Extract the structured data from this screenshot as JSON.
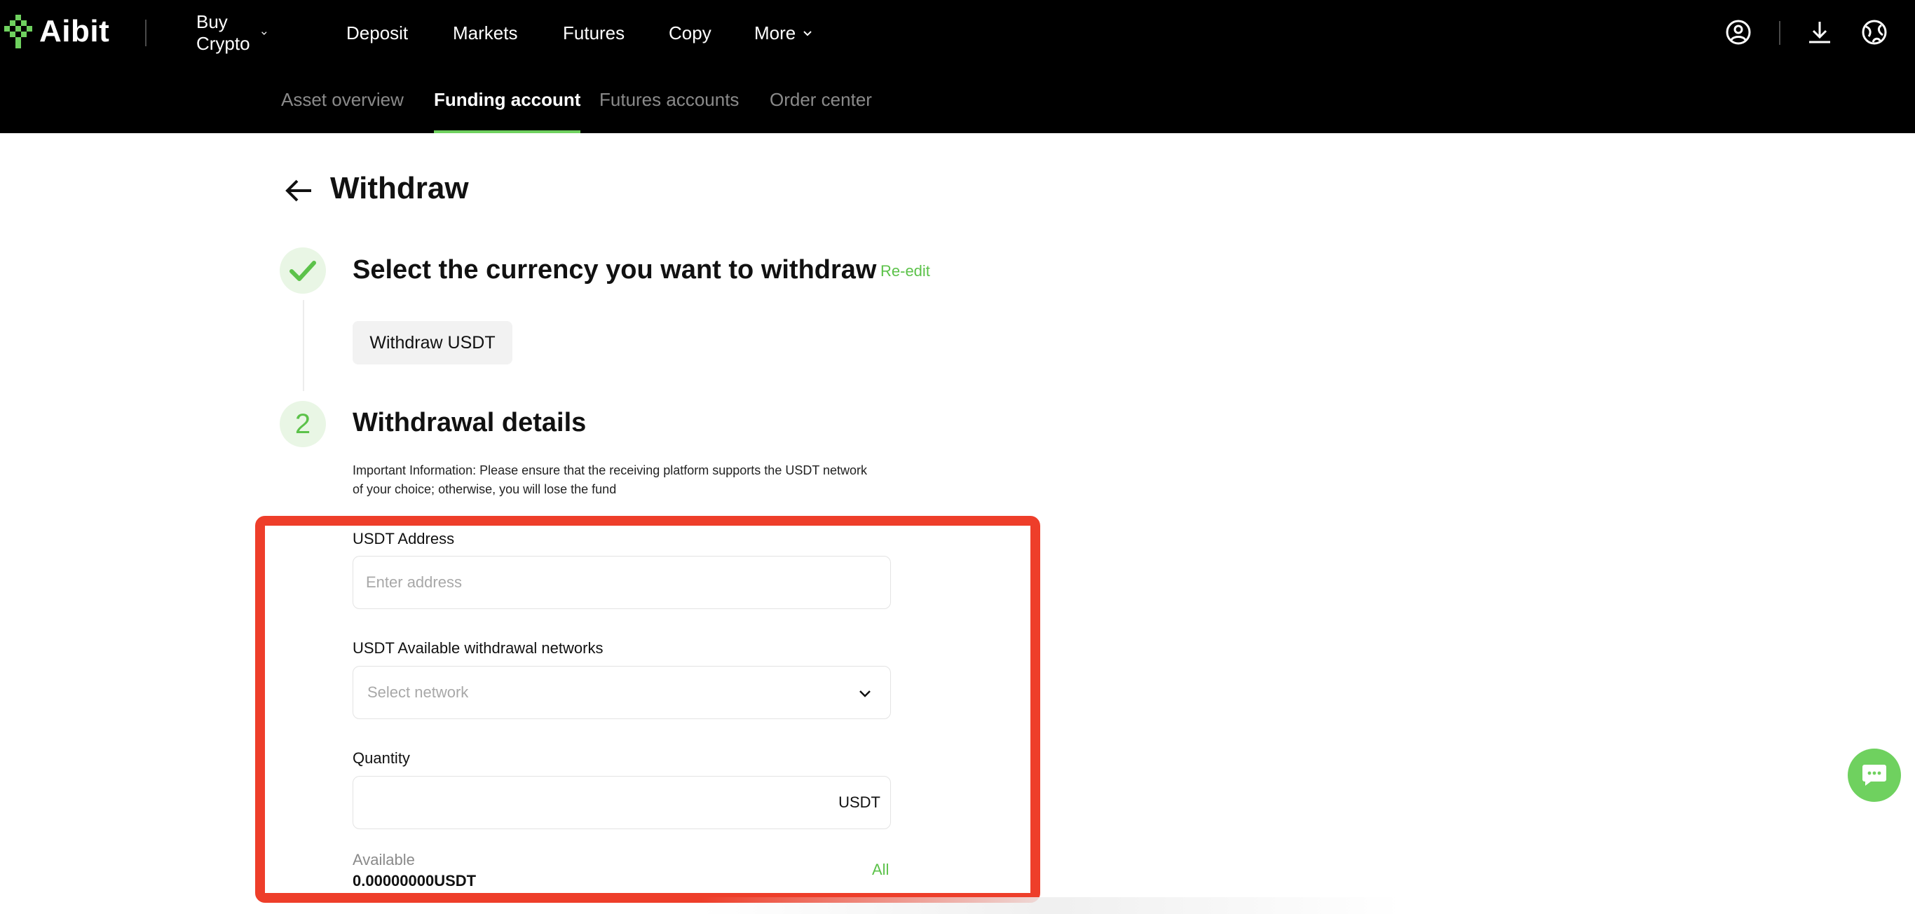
{
  "app": {
    "name": "Aibit"
  },
  "nav": {
    "items": [
      {
        "label": "Buy Crypto",
        "has_dropdown": true
      },
      {
        "label": "Deposit",
        "has_dropdown": false
      },
      {
        "label": "Markets",
        "has_dropdown": false
      },
      {
        "label": "Futures",
        "has_dropdown": false
      },
      {
        "label": "Copy",
        "has_dropdown": false
      },
      {
        "label": "More",
        "has_dropdown": true
      }
    ],
    "icons": [
      "user-icon",
      "download-icon",
      "language-icon"
    ]
  },
  "subnav": {
    "tabs": [
      {
        "label": "Asset overview",
        "active": false
      },
      {
        "label": "Funding account",
        "active": true
      },
      {
        "label": "Futures accounts",
        "active": false
      },
      {
        "label": "Order center",
        "active": false
      }
    ]
  },
  "page": {
    "title": "Withdraw"
  },
  "step1": {
    "title": "Select the currency you want to withdraw",
    "reedit_label": "Re-edit",
    "selected_chip": "Withdraw USDT"
  },
  "step2": {
    "number": "2",
    "title": "Withdrawal details",
    "info": "Important Information: Please ensure that the receiving platform supports the USDT network of your choice; otherwise, you will lose the fund"
  },
  "form": {
    "address": {
      "label": "USDT Address",
      "placeholder": "Enter address",
      "value": ""
    },
    "network": {
      "label": "USDT Available withdrawal networks",
      "placeholder": "Select network"
    },
    "quantity": {
      "label": "Quantity",
      "value": "",
      "unit": "USDT"
    },
    "available": {
      "label": "Available",
      "value": "0.00000000USDT",
      "all_label": "All"
    }
  },
  "colors": {
    "accent": "#5cc24a",
    "highlight": "#ee3e2a",
    "topbar": "#000000"
  }
}
